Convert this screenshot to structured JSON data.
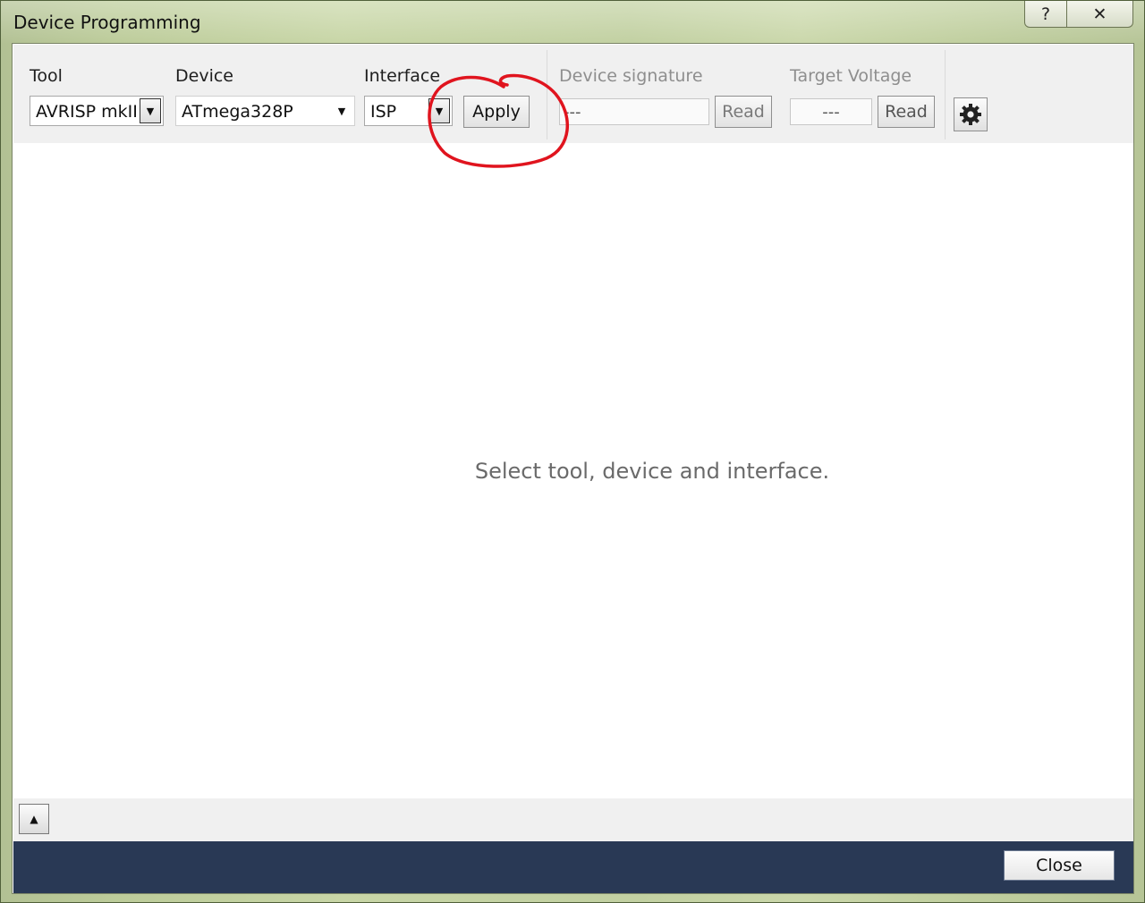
{
  "window": {
    "title": "Device Programming",
    "help_glyph": "?",
    "close_glyph": "✕"
  },
  "toolbar": {
    "tool": {
      "label": "Tool",
      "value": "AVRISP mkII"
    },
    "device": {
      "label": "Device",
      "value": "ATmega328P"
    },
    "interface": {
      "label": "Interface",
      "value": "ISP"
    },
    "apply_label": "Apply",
    "signature": {
      "label": "Device signature",
      "value": "---",
      "read_label": "Read"
    },
    "voltage": {
      "label": "Target Voltage",
      "value": "---",
      "read_label": "Read"
    },
    "settings_icon": "gear-icon"
  },
  "main": {
    "message": "Select tool, device and interface."
  },
  "bottom": {
    "expand_glyph": "▲"
  },
  "footer": {
    "close_label": "Close"
  },
  "colors": {
    "footer_bg": "#293955",
    "annotation": "#e0141e"
  }
}
